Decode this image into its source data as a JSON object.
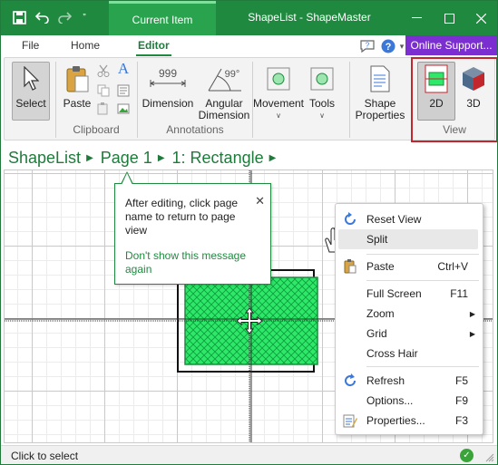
{
  "titlebar": {
    "context_tab": "Current Item",
    "window_title": "ShapeList - ShapeMaster",
    "quick_access": [
      "save-icon",
      "undo-icon",
      "redo-icon",
      "customize-icon"
    ]
  },
  "ribbon_tabs": [
    {
      "label": "File",
      "active": false
    },
    {
      "label": "Home",
      "active": false
    },
    {
      "label": "Editor",
      "active": true
    }
  ],
  "online_support": "Online Support...",
  "ribbon": {
    "select": "Select",
    "paste": "Paste",
    "dimension": "Dimension",
    "angular_1": "Angular",
    "angular_2": "Dimension",
    "dimension_value": "999",
    "angular_value": "99°",
    "movement": "Movement",
    "tools": "Tools",
    "shape_1": "Shape",
    "shape_2": "Properties",
    "view_2d": "2D",
    "view_3d": "3D",
    "groups": {
      "clipboard": "Clipboard",
      "annotations": "Annotations",
      "view": "View"
    }
  },
  "breadcrumb": [
    "ShapeList",
    "Page 1",
    "1: Rectangle"
  ],
  "tooltip": {
    "message": "After editing, click page name to return to page view",
    "dont_show": "Don't show this message again"
  },
  "context_menu": {
    "items": [
      {
        "label": "Reset View",
        "shortcut": "",
        "icon": "reset-view-icon",
        "submenu": false,
        "highlighted": false
      },
      {
        "label": "Split",
        "shortcut": "",
        "icon": "",
        "submenu": false,
        "highlighted": true
      },
      {
        "label": "Paste",
        "shortcut": "Ctrl+V",
        "icon": "paste-icon",
        "submenu": false,
        "highlighted": false
      },
      {
        "label": "Full Screen",
        "shortcut": "F11",
        "icon": "",
        "submenu": false,
        "highlighted": false
      },
      {
        "label": "Zoom",
        "shortcut": "",
        "icon": "",
        "submenu": true,
        "highlighted": false
      },
      {
        "label": "Grid",
        "shortcut": "",
        "icon": "",
        "submenu": true,
        "highlighted": false
      },
      {
        "label": "Cross Hair",
        "shortcut": "",
        "icon": "",
        "submenu": false,
        "highlighted": false
      },
      {
        "label": "Refresh",
        "shortcut": "F5",
        "icon": "refresh-icon",
        "submenu": false,
        "highlighted": false
      },
      {
        "label": "Options...",
        "shortcut": "F9",
        "icon": "",
        "submenu": false,
        "highlighted": false
      },
      {
        "label": "Properties...",
        "shortcut": "F3",
        "icon": "properties-icon",
        "submenu": false,
        "highlighted": false
      }
    ]
  },
  "status": {
    "text": "Click to select"
  },
  "colors": {
    "brand_green": "#1f8a3f",
    "online_purple": "#7b2fd0",
    "view_highlight_red": "#c1272d",
    "shape_fill": "#2ee86a"
  }
}
